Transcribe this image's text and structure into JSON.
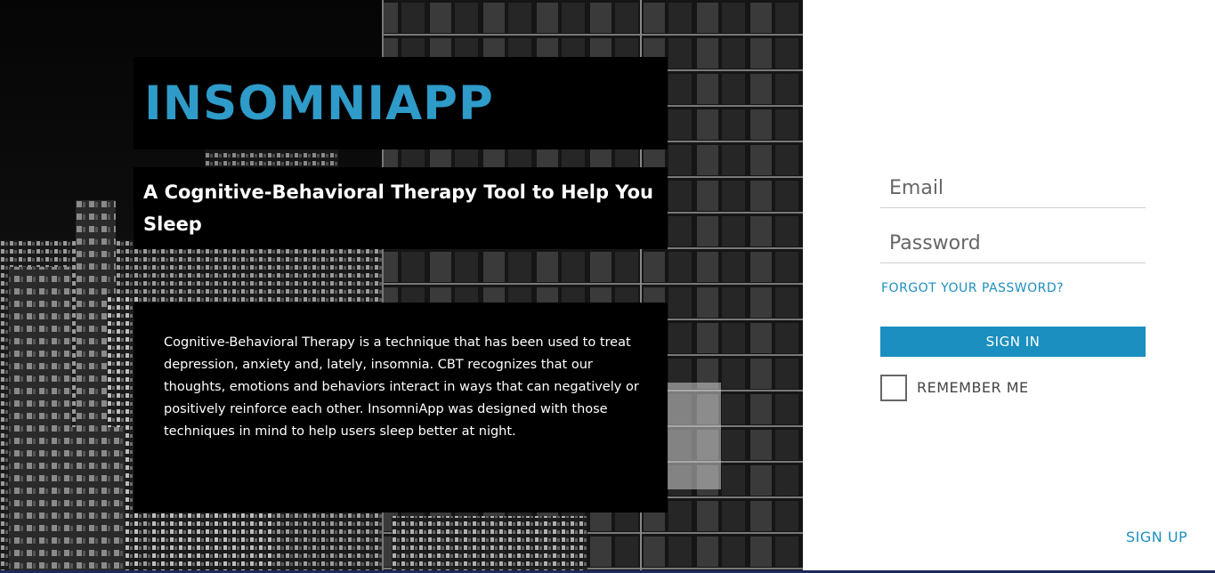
{
  "hero": {
    "app_title": "INSOMNIAPP",
    "subtitle": "A Cognitive-Behavioral Therapy Tool to Help You Sleep",
    "description": "Cognitive-Behavioral Therapy is a technique that has been used to treat depression, anxiety and, lately, insomnia. CBT recognizes that our thoughts, emotions and behaviors interact in ways that can negatively or positively reinforce each other. InsomniApp was designed with those techniques in mind to help users sleep better at night.",
    "background_image": "city-skyline-night-photo",
    "title_color": "#2f9bc9"
  },
  "login": {
    "email_placeholder": "Email",
    "email_value": "",
    "password_placeholder": "Password",
    "password_value": "",
    "forgot_label": "FORGOT YOUR PASSWORD?",
    "signin_label": "SIGN IN",
    "remember_label": "REMEMBER ME",
    "remember_checked": false,
    "signup_label": "SIGN UP",
    "accent_color": "#1a8fc0"
  }
}
